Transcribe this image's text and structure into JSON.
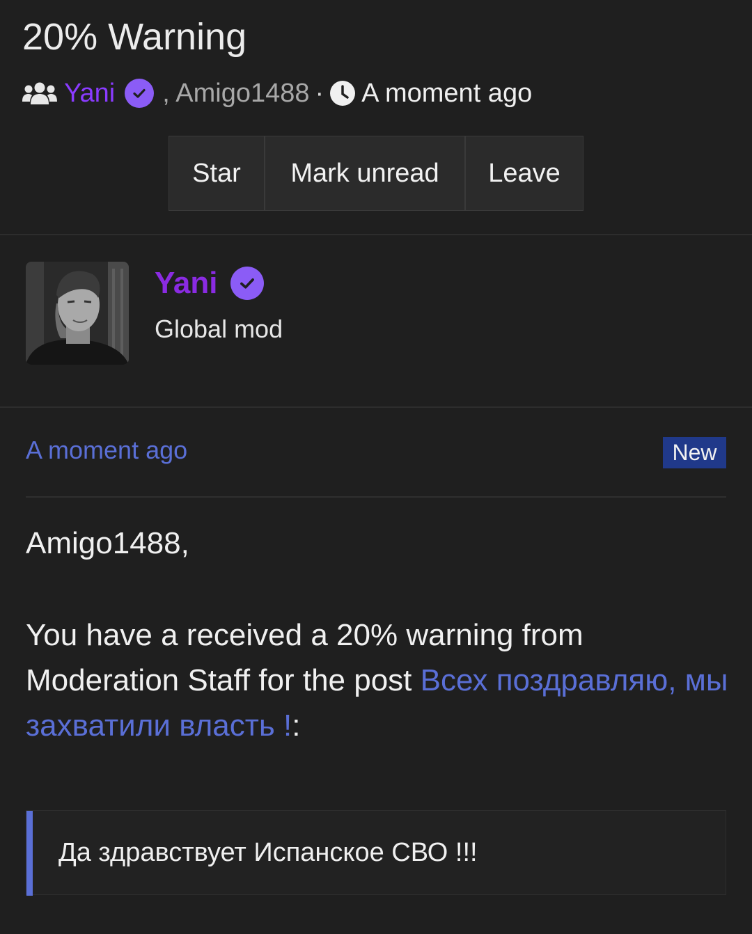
{
  "header": {
    "title": "20% Warning",
    "author": "Yani",
    "participants_rest": ", Amigo1488",
    "separator": "·",
    "time": "A moment ago"
  },
  "actions": {
    "star": "Star",
    "mark_unread": "Mark unread",
    "leave": "Leave"
  },
  "post": {
    "author_name": "Yani",
    "author_role": "Global mod",
    "time": "A moment ago",
    "badge": "New",
    "greeting": "Amigo1488,",
    "body_prefix": "You have a received a 20% warning from Moderation Staff for the post ",
    "post_link": "Всех поздравляю, мы захватили власть !",
    "body_suffix": ":",
    "quote": "Да здравствует Испанское СВО !!!"
  },
  "colors": {
    "background": "#1f1f1f",
    "author_purple": "#8a2be2",
    "verified_badge": "#8b5cf6",
    "link_blue": "#5a6fd6",
    "new_badge": "#20398a"
  },
  "icons": {
    "participants": "users-icon",
    "verified": "verified-check-icon",
    "time": "clock-icon"
  }
}
